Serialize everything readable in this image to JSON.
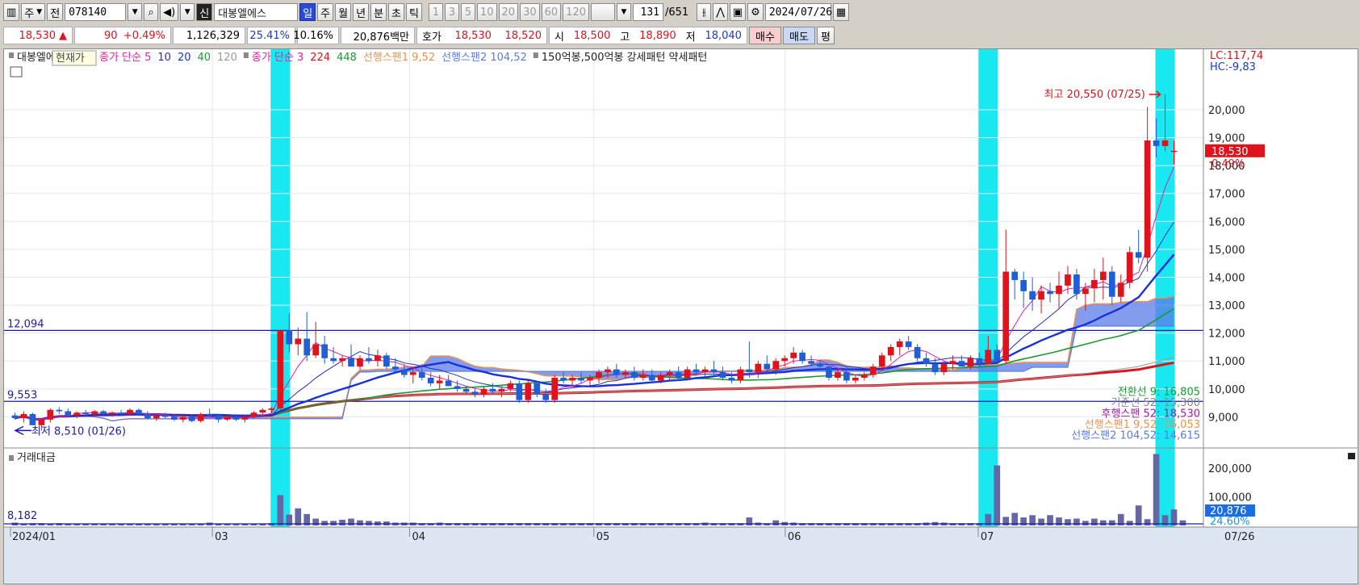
{
  "toolbar": {
    "market_label": "주",
    "prev_label": "전",
    "code": "078140",
    "shin_label": "신",
    "stock_name": "대봉엘에스",
    "periods": [
      "일",
      "주",
      "월",
      "년",
      "분",
      "초",
      "틱"
    ],
    "selected_period": "일",
    "intervals": [
      "1",
      "3",
      "5",
      "10",
      "20",
      "30",
      "60",
      "120"
    ],
    "count": "131",
    "total": "/651",
    "date": "2024/07/26"
  },
  "quote": {
    "price": "18,530",
    "change": "90",
    "change_pct": "+0.49%",
    "volume": "1,126,329",
    "ratio1": "25.41%",
    "ratio2": "10.16%",
    "amount": "20,876백만",
    "hoga_label": "호가",
    "ask": "18,530",
    "bid": "18,520",
    "open_label": "시",
    "open": "18,500",
    "high_label": "고",
    "high": "18,890",
    "low_label": "저",
    "low": "18,040",
    "buy_label": "매수",
    "sell_label": "매도",
    "flat_label": "평"
  },
  "colors": {
    "up": "#e0121b",
    "down": "#1f5fd6",
    "ma5": "#e020a0",
    "ma10": "#2030c0",
    "ma20": "#1a30d8",
    "ma40": "#1a9a30",
    "ma120": "#9a9a9a",
    "ma224": "#e0121b",
    "ma448": "#1a9a30",
    "span1": "#f0904a",
    "span2": "#5a7be8",
    "highlight": "#19e8f0",
    "hline": "#1a1aa8"
  },
  "legend": {
    "stock": "대봉엘에스",
    "tooltip": "현재가",
    "ma_a_label": "종가 단순 5",
    "ma_a_rest": [
      "10",
      "20",
      "40",
      "120"
    ],
    "ma_b_label": "종가 단순 3",
    "ma_b_rest": [
      "224",
      "448"
    ],
    "span1": "선행스팬1 9,52",
    "span2": "선행스팬2 104,52",
    "pattern": "150억봉,500억봉 강세패턴  약세패턴"
  },
  "annotations": {
    "high": "최고 20,550 (07/25)",
    "low": "최저 8,510 (01/26)",
    "hline_value": "12,094",
    "hline2_value": "9,553",
    "lc": "LC:117,74",
    "hc": "HC:-9,83",
    "price_tag": "18,530",
    "pct_tag": "0.49%",
    "ichimoku": [
      "전환선 9: 16,805",
      "기준선 52: 15,300",
      "후행스팬 52: 18,530",
      "선행스팬1 9,52: 16,053",
      "선행스팬2 104,52: 14,615"
    ]
  },
  "volume_panel": {
    "title": "거래대금",
    "ref": "8,182",
    "y_ticks": [
      "200,000",
      "100,000"
    ],
    "value_tag": "20,876",
    "pct_tag": "24.60%"
  },
  "chart_data": {
    "type": "candlestick",
    "x_labels": [
      "2024/01",
      "03",
      "04",
      "05",
      "06",
      "07",
      "07/26"
    ],
    "y_ticks": [
      9000,
      10000,
      11000,
      12000,
      13000,
      14000,
      15000,
      16000,
      17000,
      18000,
      19000,
      20000
    ],
    "ylim": [
      8000,
      21300
    ],
    "candles": [
      [
        9050,
        9150,
        8900,
        8950
      ],
      [
        8950,
        9200,
        8800,
        9100
      ],
      [
        9100,
        9150,
        8700,
        8700
      ],
      [
        8700,
        8950,
        8510,
        8900
      ],
      [
        8900,
        9300,
        8800,
        9250
      ],
      [
        9250,
        9350,
        9100,
        9200
      ],
      [
        9200,
        9300,
        9000,
        9050
      ],
      [
        9050,
        9200,
        8950,
        9150
      ],
      [
        9150,
        9250,
        9000,
        9100
      ],
      [
        9100,
        9250,
        9000,
        9200
      ],
      [
        9200,
        9250,
        9050,
        9100
      ],
      [
        9100,
        9200,
        9000,
        9150
      ],
      [
        9150,
        9250,
        9050,
        9100
      ],
      [
        9100,
        9300,
        9050,
        9250
      ],
      [
        9250,
        9300,
        9050,
        9100
      ],
      [
        9100,
        9200,
        8900,
        8950
      ],
      [
        8950,
        9100,
        8850,
        9050
      ],
      [
        9050,
        9150,
        8950,
        9000
      ],
      [
        9000,
        9100,
        8850,
        8900
      ],
      [
        8900,
        9050,
        8800,
        9000
      ],
      [
        9000,
        9100,
        8800,
        8850
      ],
      [
        8850,
        9150,
        8800,
        9100
      ],
      [
        9100,
        9300,
        9000,
        9050
      ],
      [
        9050,
        9100,
        8800,
        8900
      ],
      [
        8900,
        9050,
        8850,
        9000
      ],
      [
        9000,
        9100,
        8850,
        8900
      ],
      [
        8900,
        9050,
        8800,
        9000
      ],
      [
        9000,
        9200,
        8950,
        9150
      ],
      [
        9150,
        9300,
        9100,
        9250
      ],
      [
        9250,
        9350,
        9150,
        9300
      ],
      [
        9300,
        12100,
        9200,
        12100
      ],
      [
        12100,
        12700,
        11300,
        11600
      ],
      [
        11600,
        12200,
        11200,
        11800
      ],
      [
        11800,
        12750,
        11000,
        11200
      ],
      [
        11200,
        12400,
        11100,
        11600
      ],
      [
        11600,
        11900,
        10900,
        11100
      ],
      [
        11100,
        11500,
        10900,
        11000
      ],
      [
        11000,
        11200,
        10800,
        11100
      ],
      [
        11100,
        11600,
        10900,
        10800
      ],
      [
        10800,
        11200,
        10700,
        11100
      ],
      [
        11100,
        11500,
        10900,
        11000
      ],
      [
        11000,
        11400,
        10800,
        11200
      ],
      [
        11200,
        11300,
        10700,
        10800
      ],
      [
        10800,
        11100,
        10600,
        10700
      ],
      [
        10700,
        10900,
        10400,
        10500
      ],
      [
        10500,
        10800,
        10200,
        10600
      ],
      [
        10600,
        10900,
        10300,
        10400
      ],
      [
        10400,
        10600,
        10100,
        10200
      ],
      [
        10200,
        10500,
        10000,
        10300
      ],
      [
        10300,
        10500,
        10100,
        10100
      ],
      [
        10100,
        10300,
        9900,
        10000
      ],
      [
        10000,
        10100,
        9800,
        9900
      ],
      [
        9900,
        10000,
        9700,
        9800
      ],
      [
        9800,
        10100,
        9700,
        10000
      ],
      [
        10000,
        10200,
        9800,
        9900
      ],
      [
        9900,
        10100,
        9700,
        10000
      ],
      [
        10000,
        10300,
        9900,
        10200
      ],
      [
        10200,
        10300,
        9500,
        9600
      ],
      [
        9600,
        10300,
        9500,
        10200
      ],
      [
        10200,
        10300,
        9700,
        9800
      ],
      [
        9800,
        10000,
        9500,
        9600
      ],
      [
        9600,
        10500,
        9500,
        10400
      ],
      [
        10400,
        10600,
        10200,
        10300
      ],
      [
        10300,
        10500,
        10100,
        10400
      ],
      [
        10400,
        10600,
        10200,
        10300
      ],
      [
        10300,
        10500,
        10100,
        10400
      ],
      [
        10400,
        10700,
        10200,
        10600
      ],
      [
        10600,
        10800,
        10400,
        10700
      ],
      [
        10700,
        10900,
        10400,
        10500
      ],
      [
        10500,
        10700,
        10400,
        10600
      ],
      [
        10600,
        10800,
        10300,
        10400
      ],
      [
        10400,
        10700,
        10300,
        10500
      ],
      [
        10500,
        10700,
        10200,
        10300
      ],
      [
        10300,
        10600,
        10200,
        10500
      ],
      [
        10500,
        10700,
        10300,
        10600
      ],
      [
        10600,
        10800,
        10300,
        10400
      ],
      [
        10400,
        10800,
        10300,
        10700
      ],
      [
        10700,
        10900,
        10500,
        10600
      ],
      [
        10600,
        10800,
        10400,
        10700
      ],
      [
        10700,
        11000,
        10500,
        10600
      ],
      [
        10600,
        10800,
        10300,
        10400
      ],
      [
        10400,
        10600,
        10200,
        10300
      ],
      [
        10300,
        10800,
        10200,
        10700
      ],
      [
        10700,
        11700,
        10400,
        10600
      ],
      [
        10600,
        11000,
        10400,
        10900
      ],
      [
        10900,
        11200,
        10600,
        10700
      ],
      [
        10700,
        11100,
        10500,
        11000
      ],
      [
        11000,
        11200,
        10800,
        11100
      ],
      [
        11100,
        11500,
        10900,
        11300
      ],
      [
        11300,
        11400,
        10900,
        11000
      ],
      [
        11000,
        11200,
        10800,
        10900
      ],
      [
        10900,
        11000,
        10700,
        10800
      ],
      [
        10800,
        10900,
        10300,
        10400
      ],
      [
        10400,
        10700,
        10300,
        10600
      ],
      [
        10600,
        10800,
        10200,
        10300
      ],
      [
        10300,
        10500,
        10200,
        10400
      ],
      [
        10400,
        10600,
        10300,
        10500
      ],
      [
        10500,
        10900,
        10400,
        10800
      ],
      [
        10800,
        11300,
        10700,
        11200
      ],
      [
        11200,
        11600,
        11000,
        11500
      ],
      [
        11500,
        11800,
        11200,
        11700
      ],
      [
        11700,
        11900,
        11400,
        11500
      ],
      [
        11500,
        11600,
        11000,
        11100
      ],
      [
        11100,
        11300,
        10800,
        10900
      ],
      [
        10900,
        11100,
        10500,
        10600
      ],
      [
        10600,
        11000,
        10500,
        10900
      ],
      [
        10900,
        11200,
        10700,
        11000
      ],
      [
        11000,
        11200,
        10800,
        10800
      ],
      [
        10800,
        11200,
        10700,
        11100
      ],
      [
        11100,
        11300,
        10800,
        10900
      ],
      [
        10900,
        11900,
        10900,
        11400
      ],
      [
        11400,
        11600,
        10900,
        11000
      ],
      [
        11000,
        15700,
        10900,
        14200
      ],
      [
        14200,
        14300,
        13200,
        13900
      ],
      [
        13900,
        14200,
        12900,
        13500
      ],
      [
        13500,
        14000,
        12800,
        13200
      ],
      [
        13200,
        13700,
        12700,
        13500
      ],
      [
        13500,
        13800,
        13100,
        13400
      ],
      [
        13400,
        14200,
        12900,
        13700
      ],
      [
        13700,
        14400,
        13400,
        14100
      ],
      [
        14100,
        14300,
        13200,
        13400
      ],
      [
        13400,
        13800,
        12800,
        13600
      ],
      [
        13600,
        14300,
        13100,
        13900
      ],
      [
        13900,
        14700,
        13200,
        14200
      ],
      [
        14200,
        14400,
        13000,
        13300
      ],
      [
        13300,
        14100,
        13100,
        13800
      ],
      [
        13800,
        15100,
        13600,
        14900
      ],
      [
        14900,
        15700,
        14500,
        14700
      ],
      [
        14700,
        20100,
        14200,
        18900
      ],
      [
        18900,
        19700,
        18300,
        18700
      ],
      [
        18700,
        20550,
        18500,
        18900
      ],
      [
        18500,
        18890,
        18040,
        18530
      ]
    ],
    "volumes": [
      5,
      3,
      4,
      4,
      3,
      4,
      3,
      3,
      3,
      3,
      3,
      3,
      3,
      3,
      3,
      3,
      3,
      3,
      3,
      3,
      3,
      3,
      5,
      3,
      3,
      3,
      3,
      3,
      3,
      4,
      53,
      19,
      30,
      20,
      12,
      8,
      8,
      10,
      12,
      9,
      8,
      7,
      7,
      5,
      5,
      5,
      4,
      4,
      5,
      4,
      4,
      4,
      4,
      4,
      4,
      4,
      4,
      4,
      4,
      4,
      4,
      4,
      4,
      4,
      4,
      4,
      4,
      4,
      4,
      4,
      4,
      4,
      4,
      4,
      4,
      4,
      4,
      4,
      5,
      4,
      4,
      4,
      4,
      14,
      5,
      4,
      9,
      6,
      5,
      4,
      4,
      4,
      4,
      4,
      4,
      4,
      4,
      4,
      4,
      4,
      4,
      4,
      4,
      5,
      6,
      5,
      4,
      4,
      4,
      4,
      20,
      105,
      15,
      22,
      14,
      18,
      12,
      18,
      14,
      11,
      12,
      8,
      12,
      9,
      9,
      20,
      8,
      35,
      11,
      125,
      18,
      28,
      9
    ],
    "volume_ylim": [
      0,
      240000
    ],
    "highlight_days": [
      30,
      110,
      130
    ]
  }
}
